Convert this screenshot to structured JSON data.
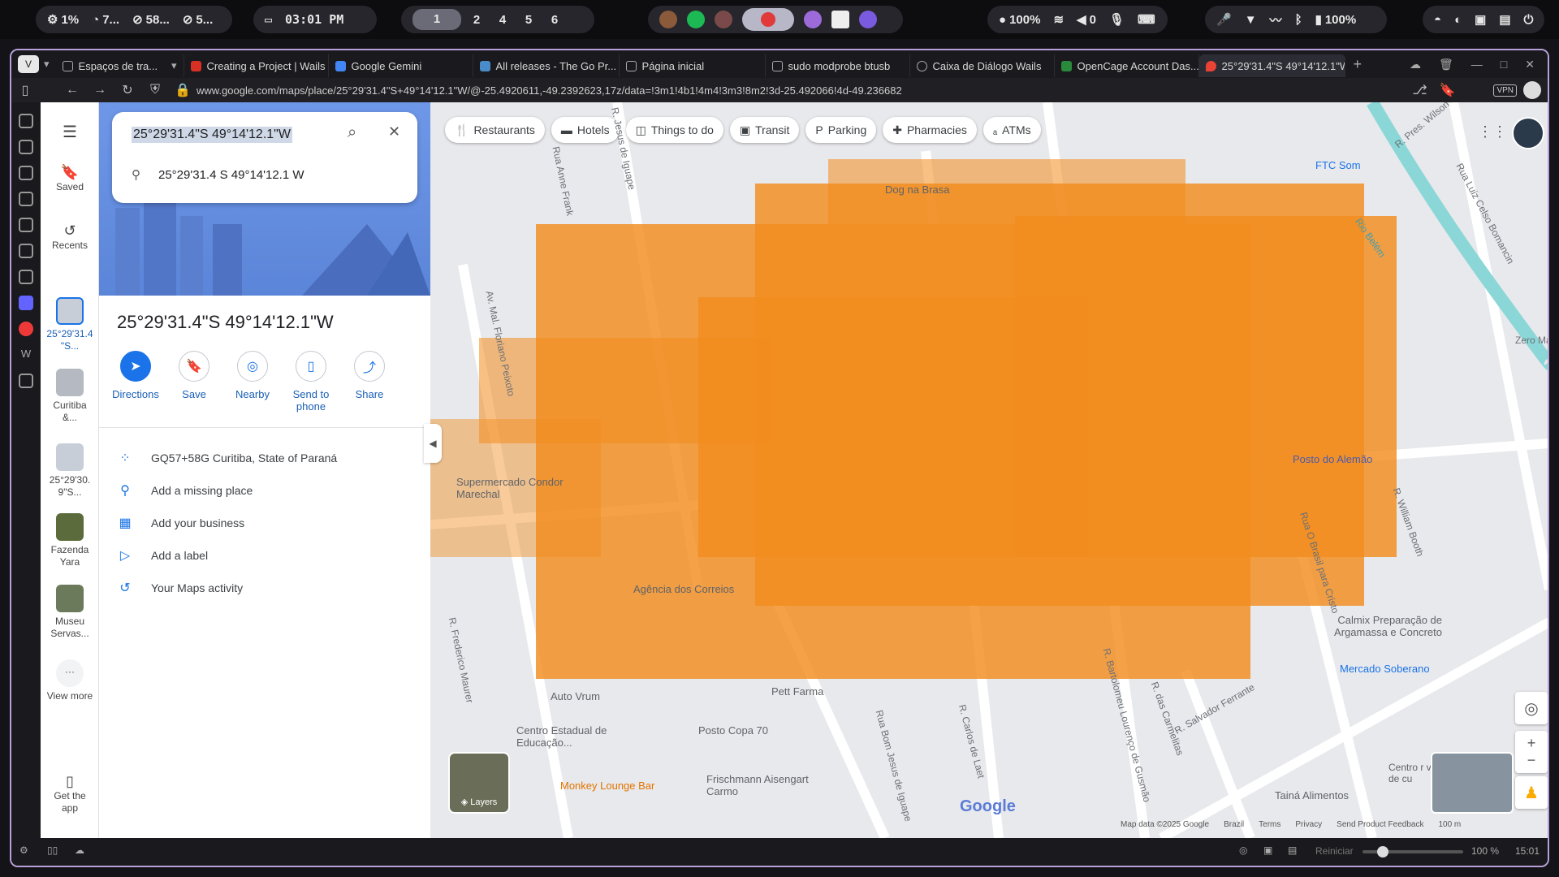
{
  "system_bar": {
    "stats": [
      "1%",
      "7...",
      "58...",
      "5..."
    ],
    "time": "03:01 PM",
    "workspaces": [
      "1",
      "2",
      "4",
      "5",
      "6"
    ],
    "right_stats": [
      "100%",
      "0"
    ],
    "battery": "100%"
  },
  "browser": {
    "tabs": [
      {
        "label": "Espaços de tra...",
        "color": "#666"
      },
      {
        "label": "Creating a Project | Wails",
        "color": "#d93025"
      },
      {
        "label": "Google Gemini",
        "color": "#4285f4"
      },
      {
        "label": "All releases - The Go Pr...",
        "color": "#4a8cc9"
      },
      {
        "label": "Página inicial",
        "color": "#888"
      },
      {
        "label": "sudo modprobe btusb",
        "color": "#aaa"
      },
      {
        "label": "Caixa de Diálogo Wails",
        "color": "#aaa"
      },
      {
        "label": "OpenCage Account Das...",
        "color": "#2a8a3c"
      },
      {
        "label": "25°29'31.4\"S 49°14'12.1\"W",
        "color": "#ea4335"
      }
    ],
    "url": "www.google.com/maps/place/25°29'31.4\"S+49°14'12.1\"W/@-25.4920611,-49.2392623,17z/data=!3m1!4b1!4m4!3m3!8m2!3d-25.492066!4d-49.236682",
    "vpn": "VPN",
    "status_right": [
      "Reiniciar",
      "100 %",
      "15:01"
    ]
  },
  "rail": {
    "saved": "Saved",
    "recents": "Recents",
    "items": [
      {
        "label": "25°29'31.4 \"S..."
      },
      {
        "label": "Curitiba &..."
      },
      {
        "label": "25°29'30. 9\"S..."
      },
      {
        "label": "Fazenda Yara"
      },
      {
        "label": "Museu Servas..."
      }
    ],
    "view_more": "View more",
    "get_app": "Get the app"
  },
  "panel": {
    "search_value": "25°29'31.4\"S 49°14'12.1\"W",
    "suggestion": "25°29'31.4 S 49°14'12.1 W",
    "title": "25°29'31.4\"S 49°14'12.1\"W",
    "actions": [
      "Directions",
      "Save",
      "Nearby",
      "Send to phone",
      "Share"
    ],
    "info": [
      "GQ57+58G Curitiba, State of Paraná",
      "Add a missing place",
      "Add your business",
      "Add a label",
      "Your Maps activity"
    ]
  },
  "map": {
    "chips": [
      "Restaurants",
      "Hotels",
      "Things to do",
      "Transit",
      "Parking",
      "Pharmacies",
      "ATMs"
    ],
    "pois": [
      "Dog na Brasa",
      "FTC Som",
      "Posto do Alemão",
      "Calmix Preparação de Argamassa e Concreto",
      "Mercado Soberano",
      "Agência dos Correios",
      "Auto Vrum",
      "Pett Farma",
      "Posto Copa 70",
      "Centro Estadual de Educação...",
      "Monkey Lounge Bar",
      "Frischmann Aisengart Carmo",
      "Tainá Alimentos",
      "Supermercado Condor Marechal",
      "Centro r veterinario de cu"
    ],
    "streets": [
      "Rua Anne Frank",
      "R. Jesus de Iguape",
      "Av. Mal. Floriano Peixoto",
      "R. Frederico Maurer",
      "Rua Bom Jesus de Iguape",
      "R. Carlos de Laet",
      "R. Bartolomeu Lourenço de Gusmão",
      "R. das Carmelitas",
      "R. Salvador Ferrante",
      "Rua O Brasil para Cristo",
      "R. William Booth",
      "R. Pres. Wilson",
      "Rua Luiz Celso Bomancin",
      "Rio Belém",
      "Zero Ma"
    ],
    "layers": "Layers",
    "logo": "Google",
    "footer": [
      "Map data ©2025 Google",
      "Brazil",
      "Terms",
      "Privacy",
      "Send Product Feedback",
      "100 m"
    ]
  }
}
